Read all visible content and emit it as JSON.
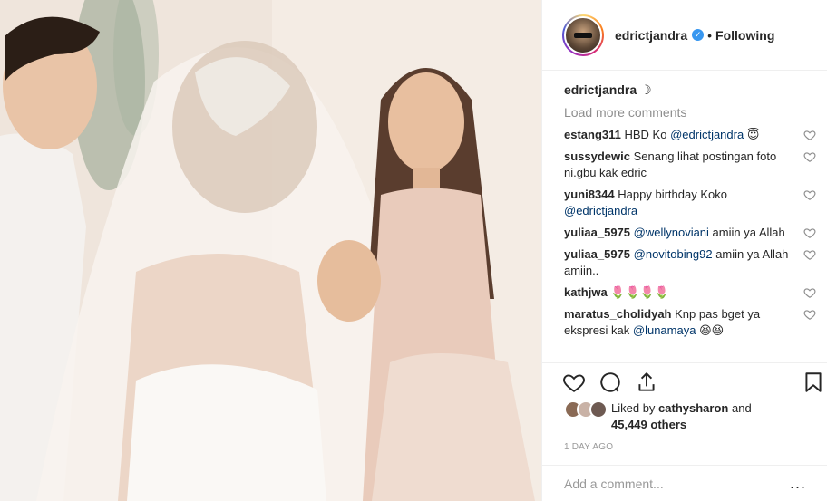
{
  "post": {
    "username": "edrictjandra",
    "verified_icon": "verified-badge-icon",
    "separator": "•",
    "follow_label": "Following"
  },
  "caption": {
    "user": "edrictjandra",
    "emoji": "☽"
  },
  "load_more": "Load more comments",
  "comments": [
    {
      "user": "estang311",
      "text": "HBD Ko ",
      "mention": "@edrictjandra",
      "suffix": " 😇"
    },
    {
      "user": "sussydewic",
      "text": "Senang lihat postingan foto ni.gbu kak edric",
      "mention": "",
      "suffix": ""
    },
    {
      "user": "yuni8344",
      "text": "Happy birthday Koko ",
      "mention": "@edrictjandra",
      "suffix": ""
    },
    {
      "user": "yuliaa_5975",
      "text": "",
      "mention": "@wellynoviani",
      "suffix": " amiin ya Allah"
    },
    {
      "user": "yuliaa_5975",
      "text": "",
      "mention": "@novitobing92",
      "suffix": " amiin ya Allah amiin.."
    },
    {
      "user": "kathjwa",
      "text": "🌷🌷🌷🌷",
      "mention": "",
      "suffix": ""
    },
    {
      "user": "maratus_cholidyah",
      "text": "Knp pas bget ya ekspresi kak ",
      "mention": "@lunamaya",
      "suffix": " 😆😆"
    }
  ],
  "likes": {
    "prefix": "Liked by",
    "user": "cathysharon",
    "middle": "and",
    "count": "45,449 others"
  },
  "timestamp": "1 DAY AGO",
  "add_comment_placeholder": "Add a comment...",
  "more_label": "...",
  "colors": {
    "story_ring": "#d62976",
    "verified": "#3897f0",
    "mention": "#003569",
    "muted": "#8e8e8e"
  }
}
